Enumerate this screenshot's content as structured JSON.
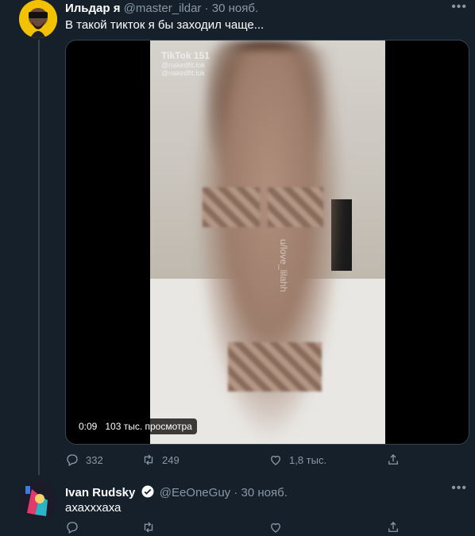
{
  "tweet1": {
    "display_name": "Ильдар я",
    "handle": "@master_ildar",
    "separator": "·",
    "date": "30 нояб.",
    "text": "В такой тикток я бы заходил чаще...",
    "more_label": "•••",
    "media": {
      "duration": "0:09",
      "views": "103 тыс. просмотра",
      "watermark_title": "TikTok 151",
      "watermark_sub1": "@nakedfit.tok",
      "watermark_sub2": "@nakedfit.tok",
      "side_text": "u/love_lilahh"
    },
    "actions": {
      "reply_count": "332",
      "retweet_count": "249",
      "like_count": "1,8 тыс."
    }
  },
  "tweet2": {
    "display_name": "Ivan Rudsky",
    "handle": "@EeOneGuy",
    "separator": "·",
    "date": "30 нояб.",
    "text": "ахахххаха",
    "more_label": "•••"
  },
  "colors": {
    "background": "#15202b",
    "secondary_text": "#8899a6",
    "border": "#38444d",
    "verified": "#ffffff"
  }
}
